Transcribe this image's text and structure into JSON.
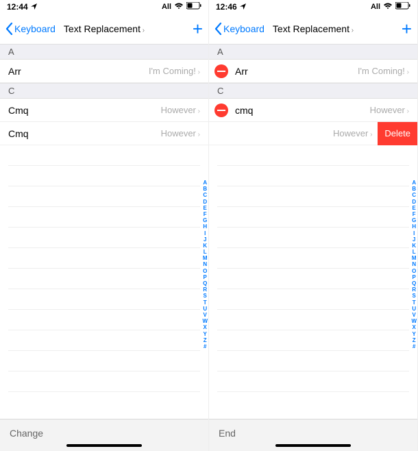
{
  "alpha_index": [
    "A",
    "B",
    "C",
    "D",
    "E",
    "F",
    "G",
    "H",
    "I",
    "J",
    "K",
    "L",
    "M",
    "N",
    "O",
    "P",
    "Q",
    "R",
    "S",
    "T",
    "U",
    "V",
    "W",
    "X",
    "Y",
    "Z",
    "#"
  ],
  "left": {
    "status_time": "12:44",
    "status_carrier": "All",
    "nav_back": "Keyboard",
    "nav_title": "Text Replacement",
    "sections": {
      "a": {
        "header": "A",
        "rows": [
          {
            "shortcut": "Arr",
            "phrase": "I'm Coming!"
          }
        ]
      },
      "c": {
        "header": "C",
        "rows": [
          {
            "shortcut": "Cmq",
            "phrase": "However"
          },
          {
            "shortcut": "Cmq",
            "phrase": "However"
          }
        ]
      }
    },
    "footer": "Change"
  },
  "right": {
    "status_time": "12:46",
    "status_carrier": "All",
    "nav_back": "Keyboard",
    "nav_title": "Text Replacement",
    "sections": {
      "a": {
        "header": "A",
        "rows": [
          {
            "shortcut": "Arr",
            "phrase": "I'm Coming!"
          }
        ]
      },
      "c": {
        "header": "C",
        "rows": [
          {
            "shortcut": "cmq",
            "phrase": "However"
          },
          {
            "shortcut": "",
            "phrase": "However",
            "delete_label": "Delete"
          }
        ]
      }
    },
    "footer": "End"
  }
}
